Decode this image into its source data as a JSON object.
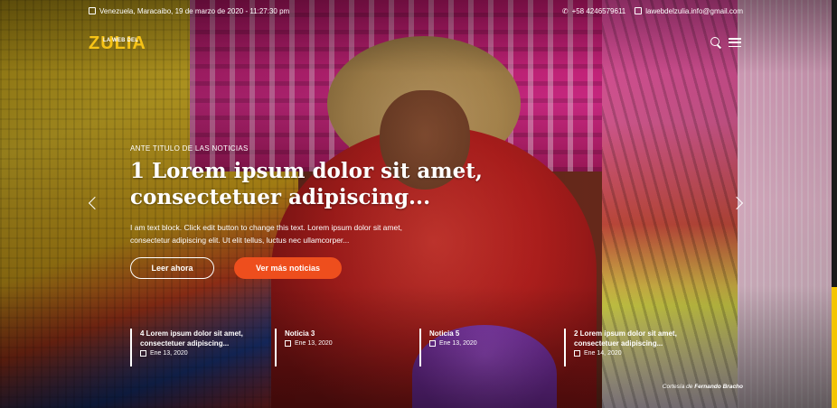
{
  "topbar": {
    "location_datetime": "Venezuela, Maracaibo, 19 de marzo de 2020 - 11:27:30 pm",
    "phone": "+58 4246579611",
    "email": "lawebdelzulia.info@gmail.com"
  },
  "logo": {
    "main": "ZULIA",
    "small": "LA WEB DEL"
  },
  "icons": {
    "search": "search-icon",
    "menu": "hamburger-menu-icon",
    "prev": "chevron-left-icon",
    "next": "chevron-right-icon"
  },
  "slide": {
    "kicker": "ANTE TITULO DE LAS NOTICIAS",
    "headline": "1 Lorem ipsum dolor sit amet, consectetuer adipiscing...",
    "excerpt": "I am text block. Click edit button to change this text. Lorem ipsum dolor sit amet, consectetur adipiscing elit. Ut elit tellus, luctus nec ullamcorper...",
    "read_button": "Leer ahora",
    "more_button": "Ver más noticias"
  },
  "news": [
    {
      "title": "4 Lorem ipsum dolor sit amet, consectetuer adipiscing...",
      "date": "Ene 13, 2020"
    },
    {
      "title": "Noticia 3",
      "date": "Ene 13, 2020"
    },
    {
      "title": "Noticia 5",
      "date": "Ene 13, 2020"
    },
    {
      "title": "2 Lorem ipsum dolor sit amet, consectetuer adipiscing...",
      "date": "Ene 14, 2020"
    }
  ],
  "credit": {
    "prefix": "Cortesía de",
    "name": "Fernando Bracho"
  },
  "colors": {
    "accent": "#ee4e1d",
    "logo": "#f6c316"
  }
}
